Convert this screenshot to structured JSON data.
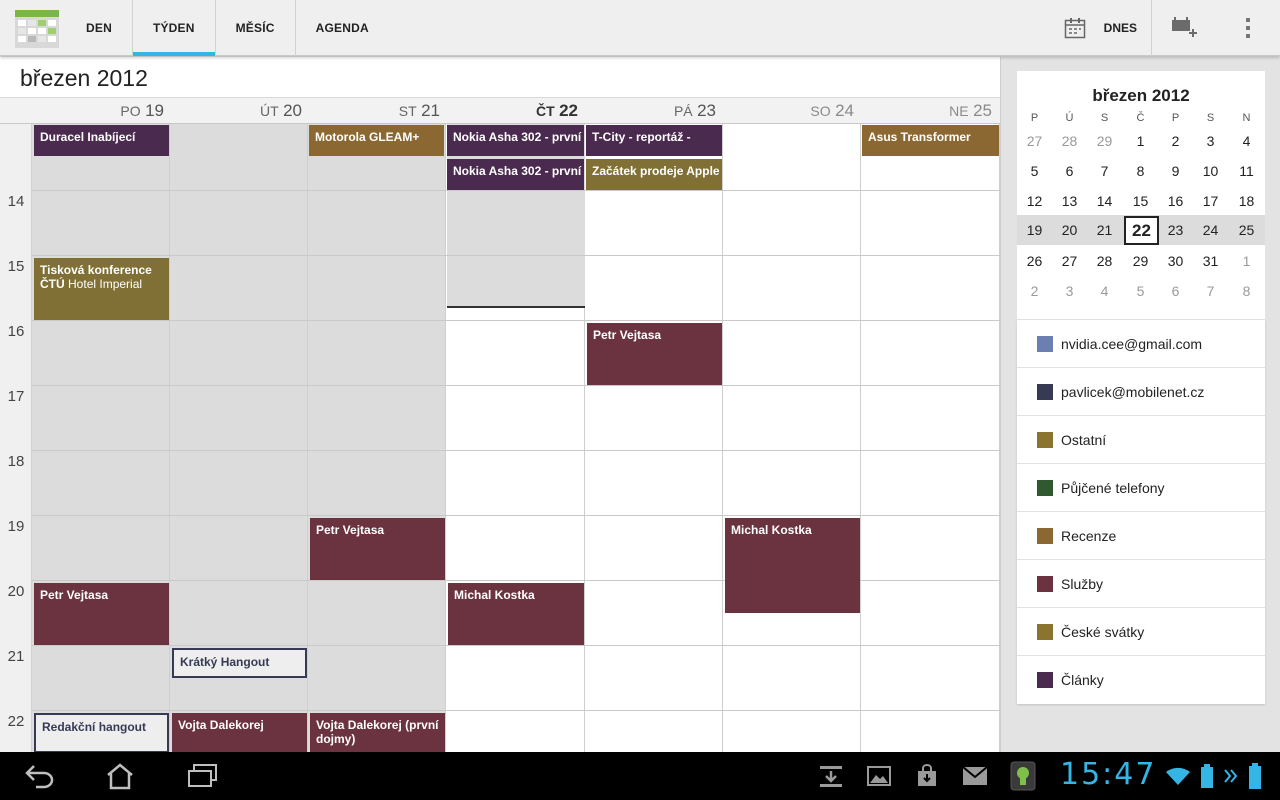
{
  "header": {
    "tabs": [
      {
        "label": "DEN"
      },
      {
        "label": "TÝDEN",
        "active": true
      },
      {
        "label": "MĚSÍC"
      },
      {
        "label": "AGENDA"
      }
    ],
    "today_label": "DNES"
  },
  "week": {
    "title": "březen 2012",
    "days": [
      {
        "name": "PO",
        "num": "19"
      },
      {
        "name": "ÚT",
        "num": "20"
      },
      {
        "name": "ST",
        "num": "21"
      },
      {
        "name": "ČT",
        "num": "22",
        "today": true
      },
      {
        "name": "PÁ",
        "num": "23"
      },
      {
        "name": "SO",
        "num": "24",
        "weekend": true
      },
      {
        "name": "NE",
        "num": "25",
        "weekend": true
      }
    ],
    "hours": [
      "14",
      "15",
      "16",
      "17",
      "18",
      "19",
      "20",
      "21",
      "22"
    ],
    "events": {
      "all_day": [
        {
          "title": "Duracel Inabíjecí",
          "color": "#4b2a4f"
        },
        {
          "title": "Motorola GLEAM+",
          "color": "#8b6832"
        },
        {
          "title": "Nokia Asha 302 - první",
          "color": "#4b2a4f"
        },
        {
          "title": "Nokia Asha 302 - první",
          "color": "#4b2a4f"
        },
        {
          "title": "T-City - reportáž -",
          "color": "#4b2a4f"
        },
        {
          "title": "Začátek prodeje Apple",
          "color": "#807035"
        },
        {
          "title": "Asus Transformer",
          "color": "#8b6832"
        }
      ],
      "timed": [
        {
          "title": "Tisková konference",
          "title2_bold": "ČTÚ",
          "title2_rest": "Hotel Imperial",
          "color": "#807035"
        },
        {
          "title": "Petr Vejtasa",
          "color": "#6b3340"
        },
        {
          "title": "Petr Vejtasa",
          "color": "#6b3340"
        },
        {
          "title": "Michal Kostka",
          "color": "#6b3340"
        },
        {
          "title": "Petr Vejtasa",
          "color": "#6b3340"
        },
        {
          "title": "Michal Kostka",
          "color": "#6b3340"
        },
        {
          "title": "Krátký Hangout",
          "color": "#363a55"
        },
        {
          "title": "Redakční hangout",
          "color": "#363a55"
        },
        {
          "title": "Vojta Dalekorej",
          "color": "#6b3340"
        },
        {
          "title": "Vojta Dalekorej (první dojmy)",
          "color": "#6b3340"
        }
      ]
    }
  },
  "mini_cal": {
    "title": "březen 2012",
    "dow": [
      "P",
      "Ú",
      "S",
      "Č",
      "P",
      "S",
      "N"
    ],
    "rows": [
      [
        "27",
        "28",
        "29",
        "1",
        "2",
        "3",
        "4"
      ],
      [
        "5",
        "6",
        "7",
        "8",
        "9",
        "10",
        "11"
      ],
      [
        "12",
        "13",
        "14",
        "15",
        "16",
        "17",
        "18"
      ],
      [
        "19",
        "20",
        "21",
        "22",
        "23",
        "24",
        "25"
      ],
      [
        "26",
        "27",
        "28",
        "29",
        "30",
        "31",
        "1"
      ],
      [
        "2",
        "3",
        "4",
        "5",
        "6",
        "7",
        "8"
      ]
    ],
    "today": "22"
  },
  "calendars": [
    {
      "name": "nvidia.cee@gmail.com",
      "color": "#6b7fb0"
    },
    {
      "name": "pavlicek@mobilenet.cz",
      "color": "#363a55"
    },
    {
      "name": "Ostatní",
      "color": "#8b7430"
    },
    {
      "name": "Půjčené telefony",
      "color": "#2f5a2f"
    },
    {
      "name": "Recenze",
      "color": "#8b6832"
    },
    {
      "name": "Služby",
      "color": "#6b3340"
    },
    {
      "name": "České svátky",
      "color": "#8b7430"
    },
    {
      "name": "Články",
      "color": "#4b2a4f"
    }
  ],
  "system": {
    "clock": "15:47"
  },
  "icons": {
    "app": "calendar-app-icon",
    "today": "calendar-today-icon",
    "new_event": "new-event-icon",
    "overflow": "overflow-menu-icon",
    "back": "back-icon",
    "home": "home-icon",
    "recents": "recent-apps-icon"
  }
}
